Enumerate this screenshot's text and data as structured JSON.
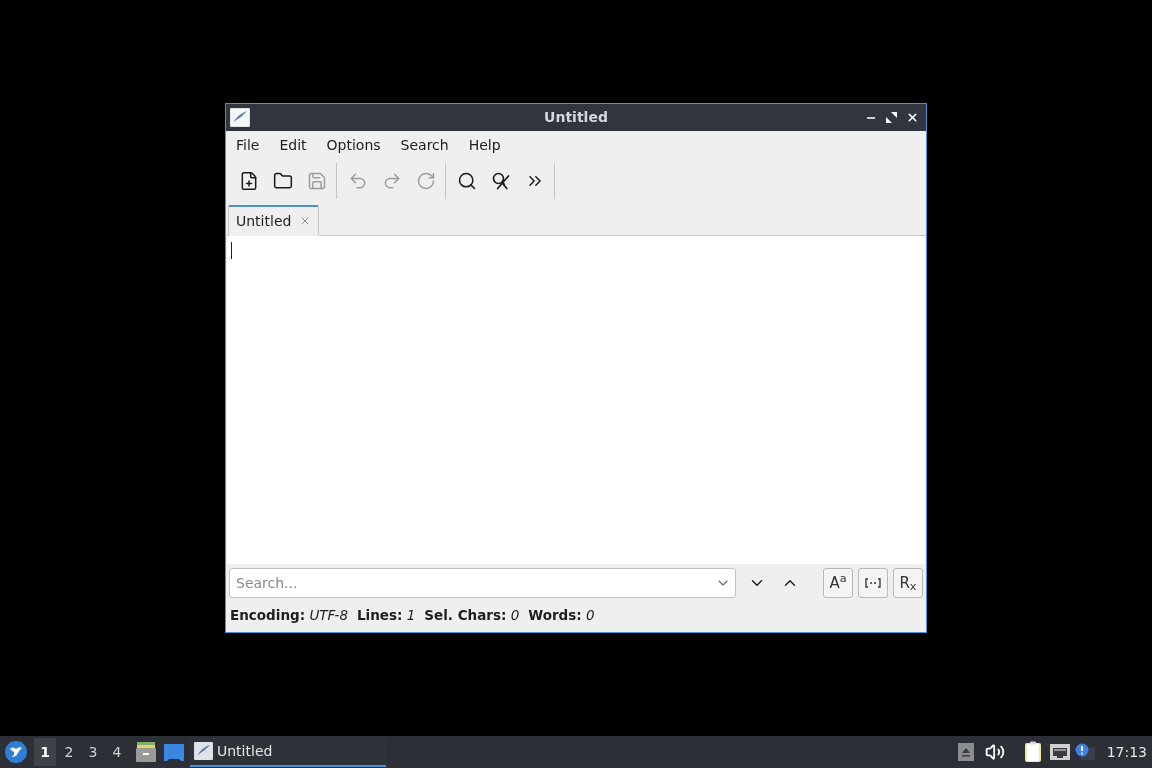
{
  "window": {
    "title": "Untitled"
  },
  "menu": [
    "File",
    "Edit",
    "Options",
    "Search",
    "Help"
  ],
  "toolbar": {
    "groups": [
      {
        "items": [
          {
            "kind": "new-file",
            "disabled": false
          },
          {
            "kind": "open",
            "disabled": false
          },
          {
            "kind": "save",
            "disabled": true
          }
        ]
      },
      {
        "items": [
          {
            "kind": "undo",
            "disabled": true
          },
          {
            "kind": "redo",
            "disabled": true
          },
          {
            "kind": "reload",
            "disabled": true
          }
        ]
      },
      {
        "items": [
          {
            "kind": "find",
            "disabled": false
          },
          {
            "kind": "replace",
            "disabled": false
          },
          {
            "kind": "more",
            "disabled": false
          }
        ]
      }
    ]
  },
  "tabs": [
    {
      "label": "Untitled",
      "selected": true
    }
  ],
  "search": {
    "placeholder": "Search...",
    "options": [
      {
        "kind": "match-case",
        "label": "A$^{a}$"
      },
      {
        "kind": "whole-word"
      },
      {
        "kind": "regex",
        "label": "R$_{x}$"
      }
    ]
  },
  "status_bar": [
    "**Encoding:** *UTF-8*",
    "**Lines:** *1*",
    "**Sel. Chars:** *0*",
    "**Words:** *0*"
  ],
  "taskbar": {
    "workspaces": [
      {
        "label": "1",
        "selected": true
      },
      {
        "label": "2",
        "selected": false
      },
      {
        "label": "3",
        "selected": false
      },
      {
        "label": "4",
        "selected": false
      }
    ],
    "tasks": [
      {
        "label": "Untitled",
        "selected": true
      }
    ],
    "clock": "17:13"
  }
}
